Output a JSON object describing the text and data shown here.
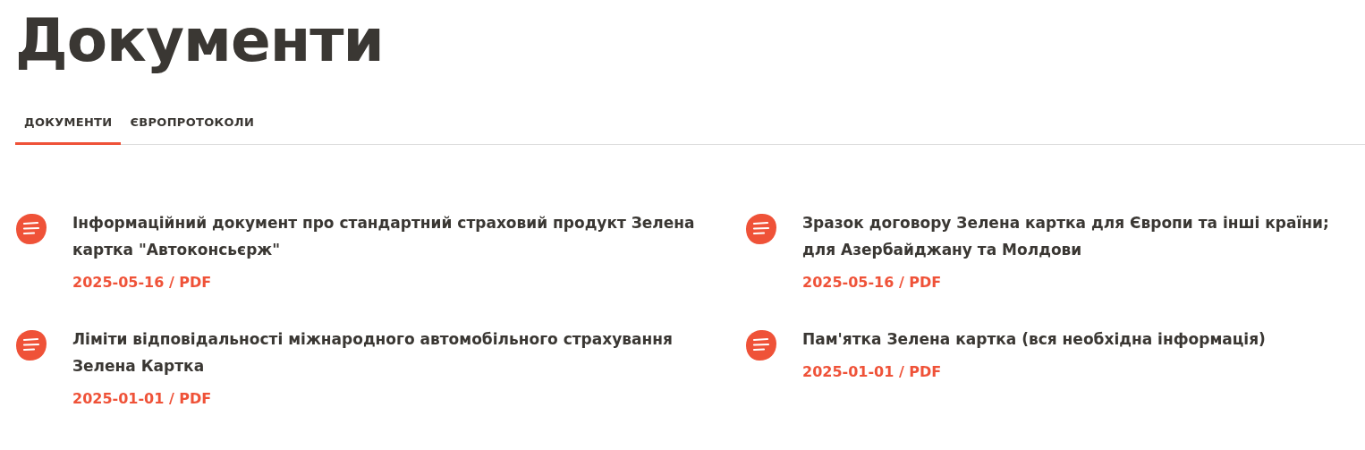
{
  "title": "Документи",
  "tabs": [
    {
      "label": "ДОКУМЕНТИ",
      "selected": true
    },
    {
      "label": "ЄВРОПРОТОКОЛИ",
      "selected": false
    }
  ],
  "documents": [
    {
      "title": "Інформаційний документ про стандартний страховий продукт Зелена картка \"Автоконсьєрж\"",
      "meta": "2025-05-16 / PDF"
    },
    {
      "title": "Зразок договору Зелена картка для Європи та інші країни; для Азербайджану та Молдови",
      "meta": "2025-05-16 / PDF"
    },
    {
      "title": "Ліміти відповідальності міжнародного автомобільного страхування Зелена Картка",
      "meta": "2025-01-01 / PDF"
    },
    {
      "title": "Пам'ятка Зелена картка (вся необхідна інформація)",
      "meta": "2025-01-01 / PDF"
    }
  ]
}
